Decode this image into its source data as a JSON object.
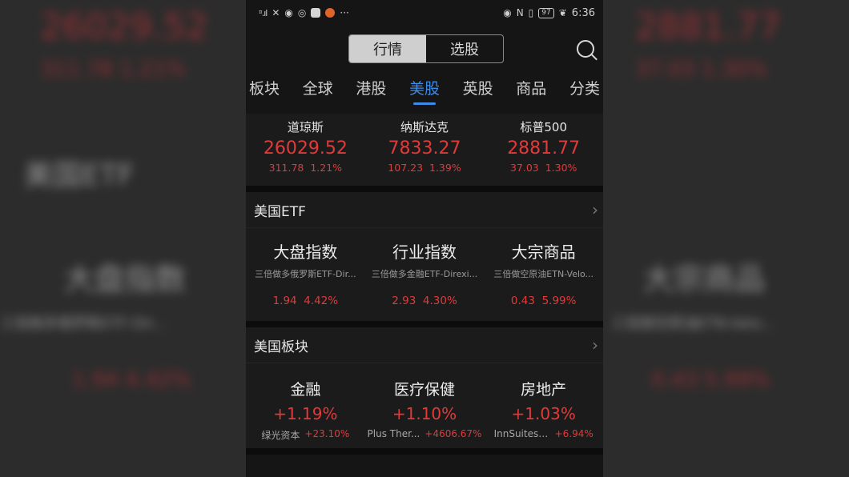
{
  "status_bar": {
    "time": "6:36",
    "battery": "97",
    "signal": "ᶦᶦ.ıl",
    "icons": [
      "signal-icon",
      "wechat-icon",
      "weibo-icon",
      "chrome-icon",
      "app-icon",
      "app-icon-2",
      "more-icon",
      "eye-icon",
      "nfc-icon",
      "vibrate-icon",
      "battery-icon",
      "leaf-icon"
    ],
    "more": "···"
  },
  "top_segment": {
    "options": [
      "行情",
      "选股"
    ],
    "selected": "行情"
  },
  "tabs": [
    "板块",
    "全球",
    "港股",
    "美股",
    "英股",
    "商品",
    "分类"
  ],
  "active_tab": "美股",
  "indices": [
    {
      "name": "道琼斯",
      "value": "26029.52",
      "change": "311.78",
      "pct": "1.21%"
    },
    {
      "name": "纳斯达克",
      "value": "7833.27",
      "change": "107.23",
      "pct": "1.39%"
    },
    {
      "name": "标普500",
      "value": "2881.77",
      "change": "37.03",
      "pct": "1.30%"
    }
  ],
  "etf_section": {
    "title": "美国ETF",
    "items": [
      {
        "name": "大盘指数",
        "sub": "三倍做多俄罗斯ETF-Dir...",
        "change": "1.94",
        "pct": "4.42%"
      },
      {
        "name": "行业指数",
        "sub": "三倍做多金融ETF-Direxi...",
        "change": "2.93",
        "pct": "4.30%"
      },
      {
        "name": "大宗商品",
        "sub": "三倍做空原油ETN-Velo...",
        "change": "0.43",
        "pct": "5.99%"
      }
    ]
  },
  "sector_section": {
    "title": "美国板块",
    "items": [
      {
        "name": "金融",
        "pct": "+1.19%",
        "stock": "绿光资本",
        "stock_pct": "+23.10%"
      },
      {
        "name": "医疗保健",
        "pct": "+1.10%",
        "stock": "Plus Ther...",
        "stock_pct": "+4606.67%"
      },
      {
        "name": "房地产",
        "pct": "+1.03%",
        "stock": "InnSuites ...",
        "stock_pct": "+6.94%"
      }
    ]
  },
  "colors": {
    "up": "#e03a3a",
    "accent": "#3d8ce8",
    "bg": "#151515"
  },
  "bg_blur": {
    "left_value": "26029.52",
    "left_sub": "311.78 1.21%",
    "left_title": "美国ETF",
    "left_name": "大盘指数",
    "left_line": "三倍做多俄罗斯ETF-Dir...",
    "left_change": "1.94 4.42%",
    "right_value": "2881.77",
    "right_sub": "37.03 1.30%",
    "right_name": "大宗商品",
    "right_line": "三倍做空原油ETN-Velo...",
    "right_change": "0.43 5.99%"
  }
}
